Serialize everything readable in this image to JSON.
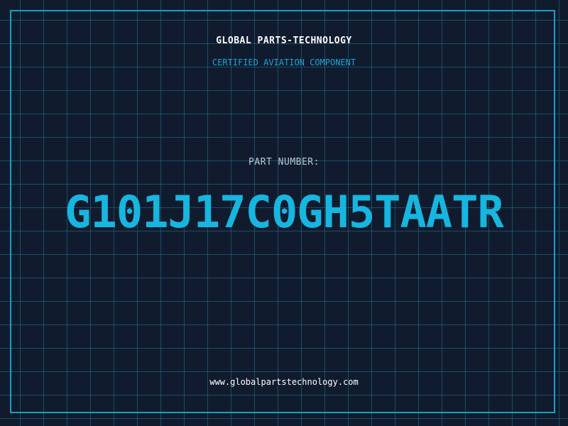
{
  "label": {
    "company": "GLOBAL PARTS-TECHNOLOGY",
    "tagline": "CERTIFIED AVIATION COMPONENT",
    "part_number_label": "PART NUMBER:",
    "part_number": "G101J17C0GH5TAATR",
    "website": "www.globalpartstechnology.com"
  },
  "colors": {
    "background": "#111b2e",
    "grid": "#1e7896",
    "frame": "#1a9fc6",
    "accent": "#16b6e0",
    "text": "#ffffff",
    "muted_text": "#b8c8d8"
  }
}
